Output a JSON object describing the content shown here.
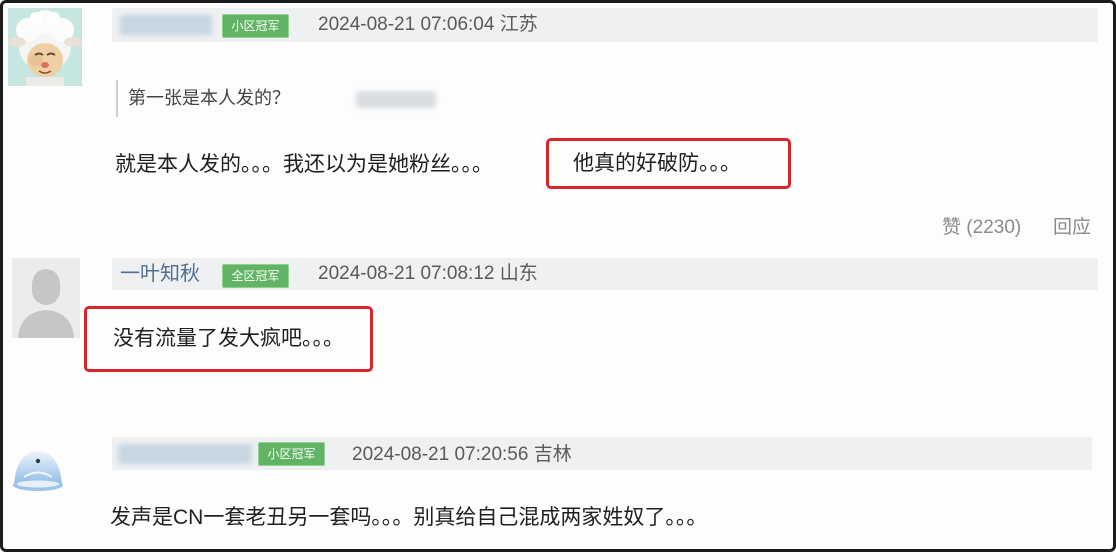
{
  "comments": [
    {
      "badge": "小区冠军",
      "timestamp": "2024-08-21 07:06:04 江苏",
      "quote": "第一张是本人发的？",
      "text": "就是本人发的。。。我还以为是她粉丝。。。",
      "highlighted_text": "他真的好破防。。。",
      "like_label": "赞",
      "like_count": "(2230)",
      "reply_label": "回应",
      "avatar_icon": "sheep-cartoon-avatar"
    },
    {
      "username": "一叶知秋",
      "badge": "全区冠军",
      "timestamp": "2024-08-21 07:08:12 山东",
      "highlighted_text": "没有流量了发大疯吧。。。",
      "avatar_icon": "default-user-silhouette-avatar"
    },
    {
      "badge": "小区冠军",
      "timestamp": "2024-08-21 07:20:56 吉林",
      "text": "发声是CN一套老丑另一套吗。。。别真给自己混成两家姓奴了。。。",
      "avatar_icon": "blue-dome-avatar"
    }
  ],
  "colors": {
    "highlight_border": "#d8262b",
    "badge_green": "#60b463",
    "username_blue": "#4f6f95",
    "header_band": "#eef0f1",
    "frame_border": "#1c1c1c"
  }
}
